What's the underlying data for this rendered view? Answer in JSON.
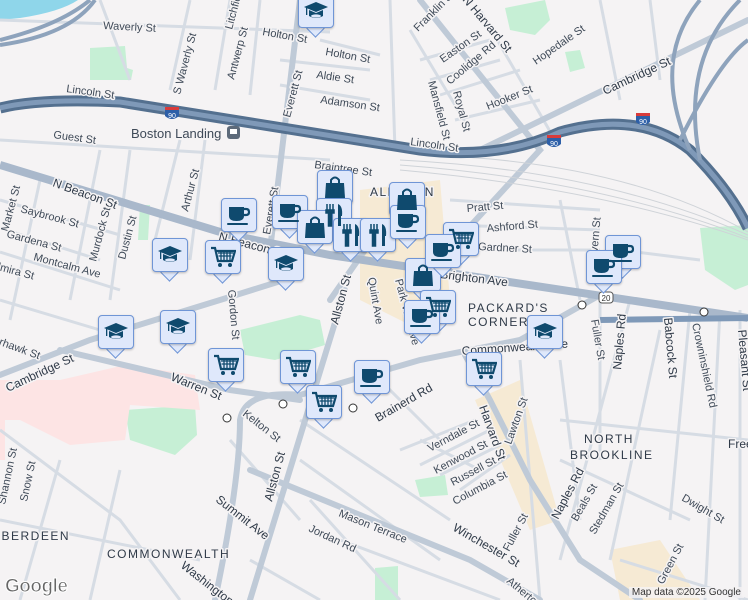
{
  "map": {
    "streets": {
      "waverly": "Waverly St",
      "holton1": "Holton St",
      "holton2": "Holton St",
      "litchfield": "Litchfield St",
      "s_waverly": "S Waverly St",
      "antwerp": "Antwerp St",
      "everett1": "Everett St",
      "aldie": "Aldie St",
      "adamson": "Adamson St",
      "lincoln1": "Lincoln St",
      "guest": "Guest St",
      "braintree": "Braintree St",
      "n_beacon1": "N Beacon St",
      "n_beacon2": "N Beacon St",
      "arthur": "Arthur St",
      "everett2": "Everett St",
      "market": "Market St",
      "saybrook": "Saybrook St",
      "murdock": "Murdock St",
      "dustin": "Dustin St",
      "gardena": "Gardena St",
      "montcalm": "Montcalm Ave",
      "elmira": "Elmira St",
      "gordon": "Gordon St",
      "allston1": "Allston St",
      "quint": "Quint Ave",
      "park_vale": "Park Vale Ave",
      "franklin": "Franklin St",
      "n_harvard": "N Harvard St",
      "easton": "Easton St",
      "coolidge": "Coolidge Rd",
      "mansfield": "Mansfield St",
      "royal": "Royal St",
      "hooker": "Hooker St",
      "hopedale": "Hopedale St",
      "cambridge1": "Cambridge St",
      "lincoln2": "Lincoln St",
      "pratt": "Pratt St",
      "ashford": "Ashford St",
      "gardner": "Gardner St",
      "brighton": "Brighton Ave",
      "malvern": "Malvern St",
      "commonwealth_ave": "Commonwealth Ave",
      "fuller1": "Fuller St",
      "naples1": "Naples Rd",
      "babcock": "Babcock St",
      "crowninshield": "Crowninshield Rd",
      "pleasant": "Pleasant St",
      "warren": "Warren St",
      "cambridge2": "Cambridge St",
      "sparhawk": "Sparhawk St",
      "brainerd": "Brainerd Rd",
      "kelton": "Kelton St",
      "allston2": "Allston St",
      "verndale": "Verndale St",
      "kenwood": "Kenwood St",
      "russell": "Russell St",
      "columbia": "Columbia St",
      "harvard": "Harvard St",
      "lawton": "Lawton St",
      "naples2": "Naples Rd",
      "beals": "Beals St",
      "stedman": "Stedman St",
      "dwight": "Dwight St",
      "freeman": "Freeman St",
      "fuller2": "Fuller St",
      "green": "Green St",
      "winchester": "Winchester St",
      "mason": "Mason Terrace",
      "jordan": "Jordan Rd",
      "summit": "Summit Ave",
      "shannon": "Shannon St",
      "snow": "Snow St",
      "washington": "Washington St",
      "atherton": "Atherton Rd"
    },
    "areas": {
      "allston": "ALLSTON",
      "packards": "PACKARD'S",
      "corner": "CORNER",
      "north": "NORTH",
      "brookline": "BROOKLINE",
      "aberdeen": "ABERDEEN",
      "commonwealth": "COMMONWEALTH"
    },
    "poi": {
      "boston_landing": "Boston Landing"
    },
    "highway_shields": {
      "i90": "90",
      "us20": "20"
    },
    "colors": {
      "background": "#f5f3f4",
      "highway": "#6f88a8",
      "arterial": "#a9b8cb",
      "minor": "#d6dce4",
      "park": "#c6efd5",
      "hospital": "#fde4e4",
      "water": "#8fd6ea",
      "marker_fill": "#dfe8fb",
      "marker_border": "#6f95d6",
      "icon": "#0f4a6e"
    }
  },
  "markers": [
    "school",
    "school",
    "grocery",
    "cafe",
    "cafe",
    "shopping",
    "restaurant",
    "shopping",
    "school",
    "restaurant",
    "shopping",
    "restaurant",
    "cafe",
    "grocery",
    "shopping",
    "cafe",
    "grocery",
    "school",
    "school",
    "grocery",
    "grocery",
    "grocery",
    "cafe",
    "grocery",
    "school",
    "cafe",
    "cafe",
    "cafe"
  ],
  "footer": {
    "attribution": "Map data ©2025 Google",
    "logo": "Google"
  }
}
